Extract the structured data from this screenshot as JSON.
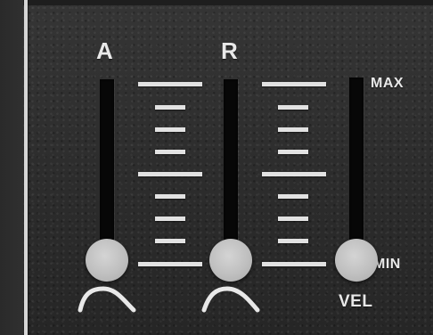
{
  "labels": {
    "attack": "A",
    "release": "R",
    "max": "MAX",
    "min": "MIN",
    "velocity": "VEL"
  },
  "sliders": [
    {
      "name": "attack",
      "level": 0.0
    },
    {
      "name": "release",
      "level": 0.0
    },
    {
      "name": "velocity",
      "level": 0.0
    }
  ],
  "colors": {
    "panel": "#2f2f2f",
    "track": "#070707",
    "knob": "#c4c4c4",
    "markings": "#e2e2e2"
  },
  "icons": {
    "attack_curve": "attack-curve-icon",
    "release_curve": "release-curve-icon"
  }
}
